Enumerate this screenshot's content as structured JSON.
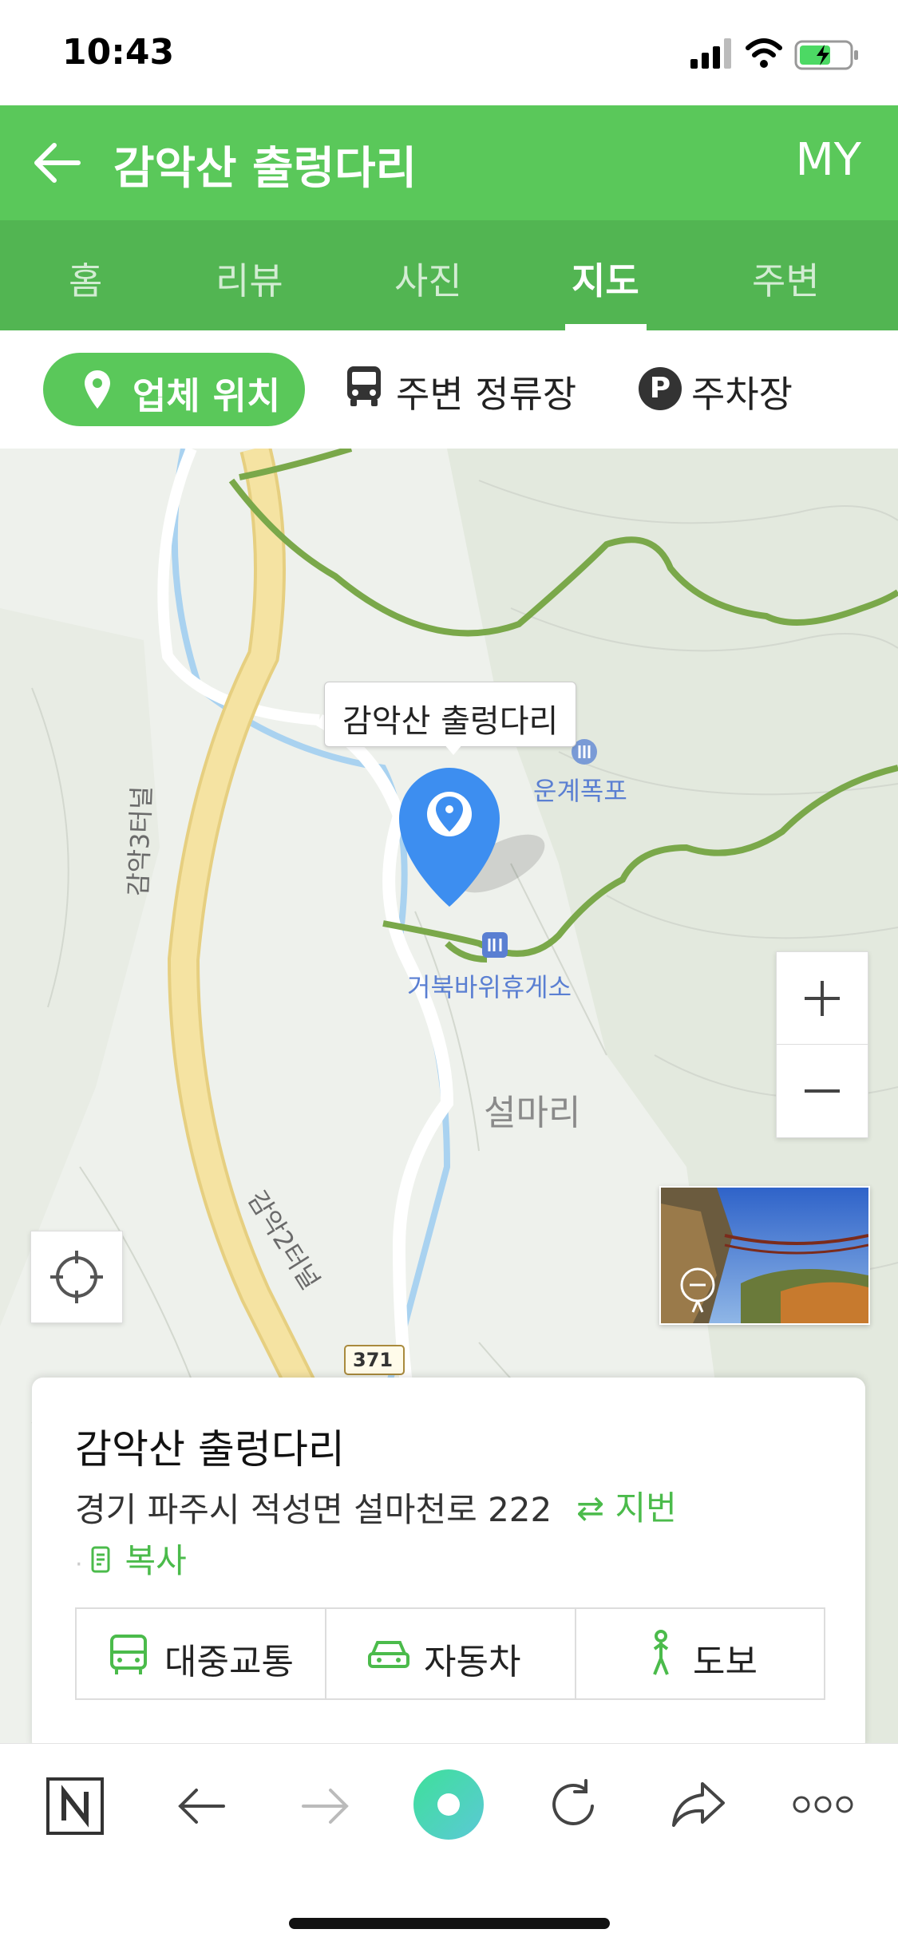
{
  "status_bar": {
    "time": "10:43"
  },
  "header": {
    "title": "감악산 출렁다리",
    "my_label": "MY"
  },
  "tabs": [
    {
      "label": "홈",
      "active": false
    },
    {
      "label": "리뷰",
      "active": false
    },
    {
      "label": "사진",
      "active": false
    },
    {
      "label": "지도",
      "active": true
    },
    {
      "label": "주변",
      "active": false
    }
  ],
  "filters": {
    "business_location": "업체 위치",
    "nearby_stops": "주변 정류장",
    "parking": "주차장",
    "parking_badge": "P"
  },
  "map": {
    "callout": "감악산 출렁다리",
    "labels": {
      "waterfall": "운계폭포",
      "rest_area": "거북바위휴게소",
      "village": "설마리",
      "tunnel_3": "감악3터널",
      "tunnel_2": "감악2터널",
      "route": "371"
    },
    "colors": {
      "pin": "#3d8ef0",
      "trail": "#7aa84a",
      "road": "#f5e3a2",
      "water": "#a9d2f0"
    }
  },
  "place_card": {
    "name": "감악산 출렁다리",
    "address": "경기 파주시 적성면 설마천로 222",
    "jibun_label": "지번",
    "copy_label": "복사",
    "modes": [
      {
        "label": "대중교통",
        "icon": "bus-icon"
      },
      {
        "label": "자동차",
        "icon": "car-icon"
      },
      {
        "label": "도보",
        "icon": "walk-icon"
      }
    ]
  },
  "browser_toolbar": {
    "icons": [
      "naver-home-icon",
      "back-icon",
      "forward-icon",
      "green-dot-icon",
      "reload-icon",
      "share-icon",
      "more-icon"
    ]
  }
}
